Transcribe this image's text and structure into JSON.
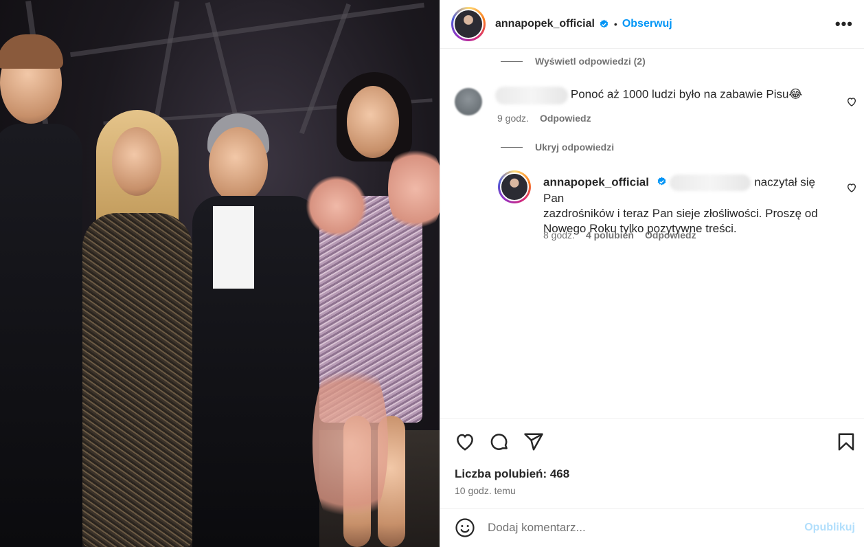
{
  "header": {
    "username": "annapopek_official",
    "follow_label": "Obserwuj",
    "dot": "•",
    "more": "•••"
  },
  "comments": {
    "view_replies": "Wyświetl odpowiedzi (2)",
    "comment1": {
      "text": "Ponoć aż 1000 ludzi było na zabawie Pisu😂",
      "time": "9 godz.",
      "reply": "Odpowiedz"
    },
    "hide_replies": "Ukryj odpowiedzi",
    "reply1": {
      "username": "annapopek_official",
      "text_line1": "naczytał się Pan",
      "text_line2": "zazdrośników i teraz Pan sieje złośliwości. Proszę od",
      "text_line3": "Nowego Roku tylko pozytywne treści.",
      "time": "8 godz.",
      "likes": "4 polubień",
      "reply": "Odpowiedz"
    }
  },
  "actions": {
    "likes_label": "Liczba polubień: 468",
    "time_ago": "10 godz. temu"
  },
  "add_comment": {
    "placeholder": "Dodaj komentarz...",
    "publish_label": "Opublikuj"
  },
  "colors": {
    "accent": "#0095f6",
    "muted": "#737373",
    "verified": "#0095f6",
    "publish_disabled": "#b2dffc"
  },
  "icons": [
    "heart-icon",
    "comment-icon",
    "share-icon",
    "bookmark-icon",
    "emoji-icon",
    "verified-icon",
    "more-icon"
  ]
}
